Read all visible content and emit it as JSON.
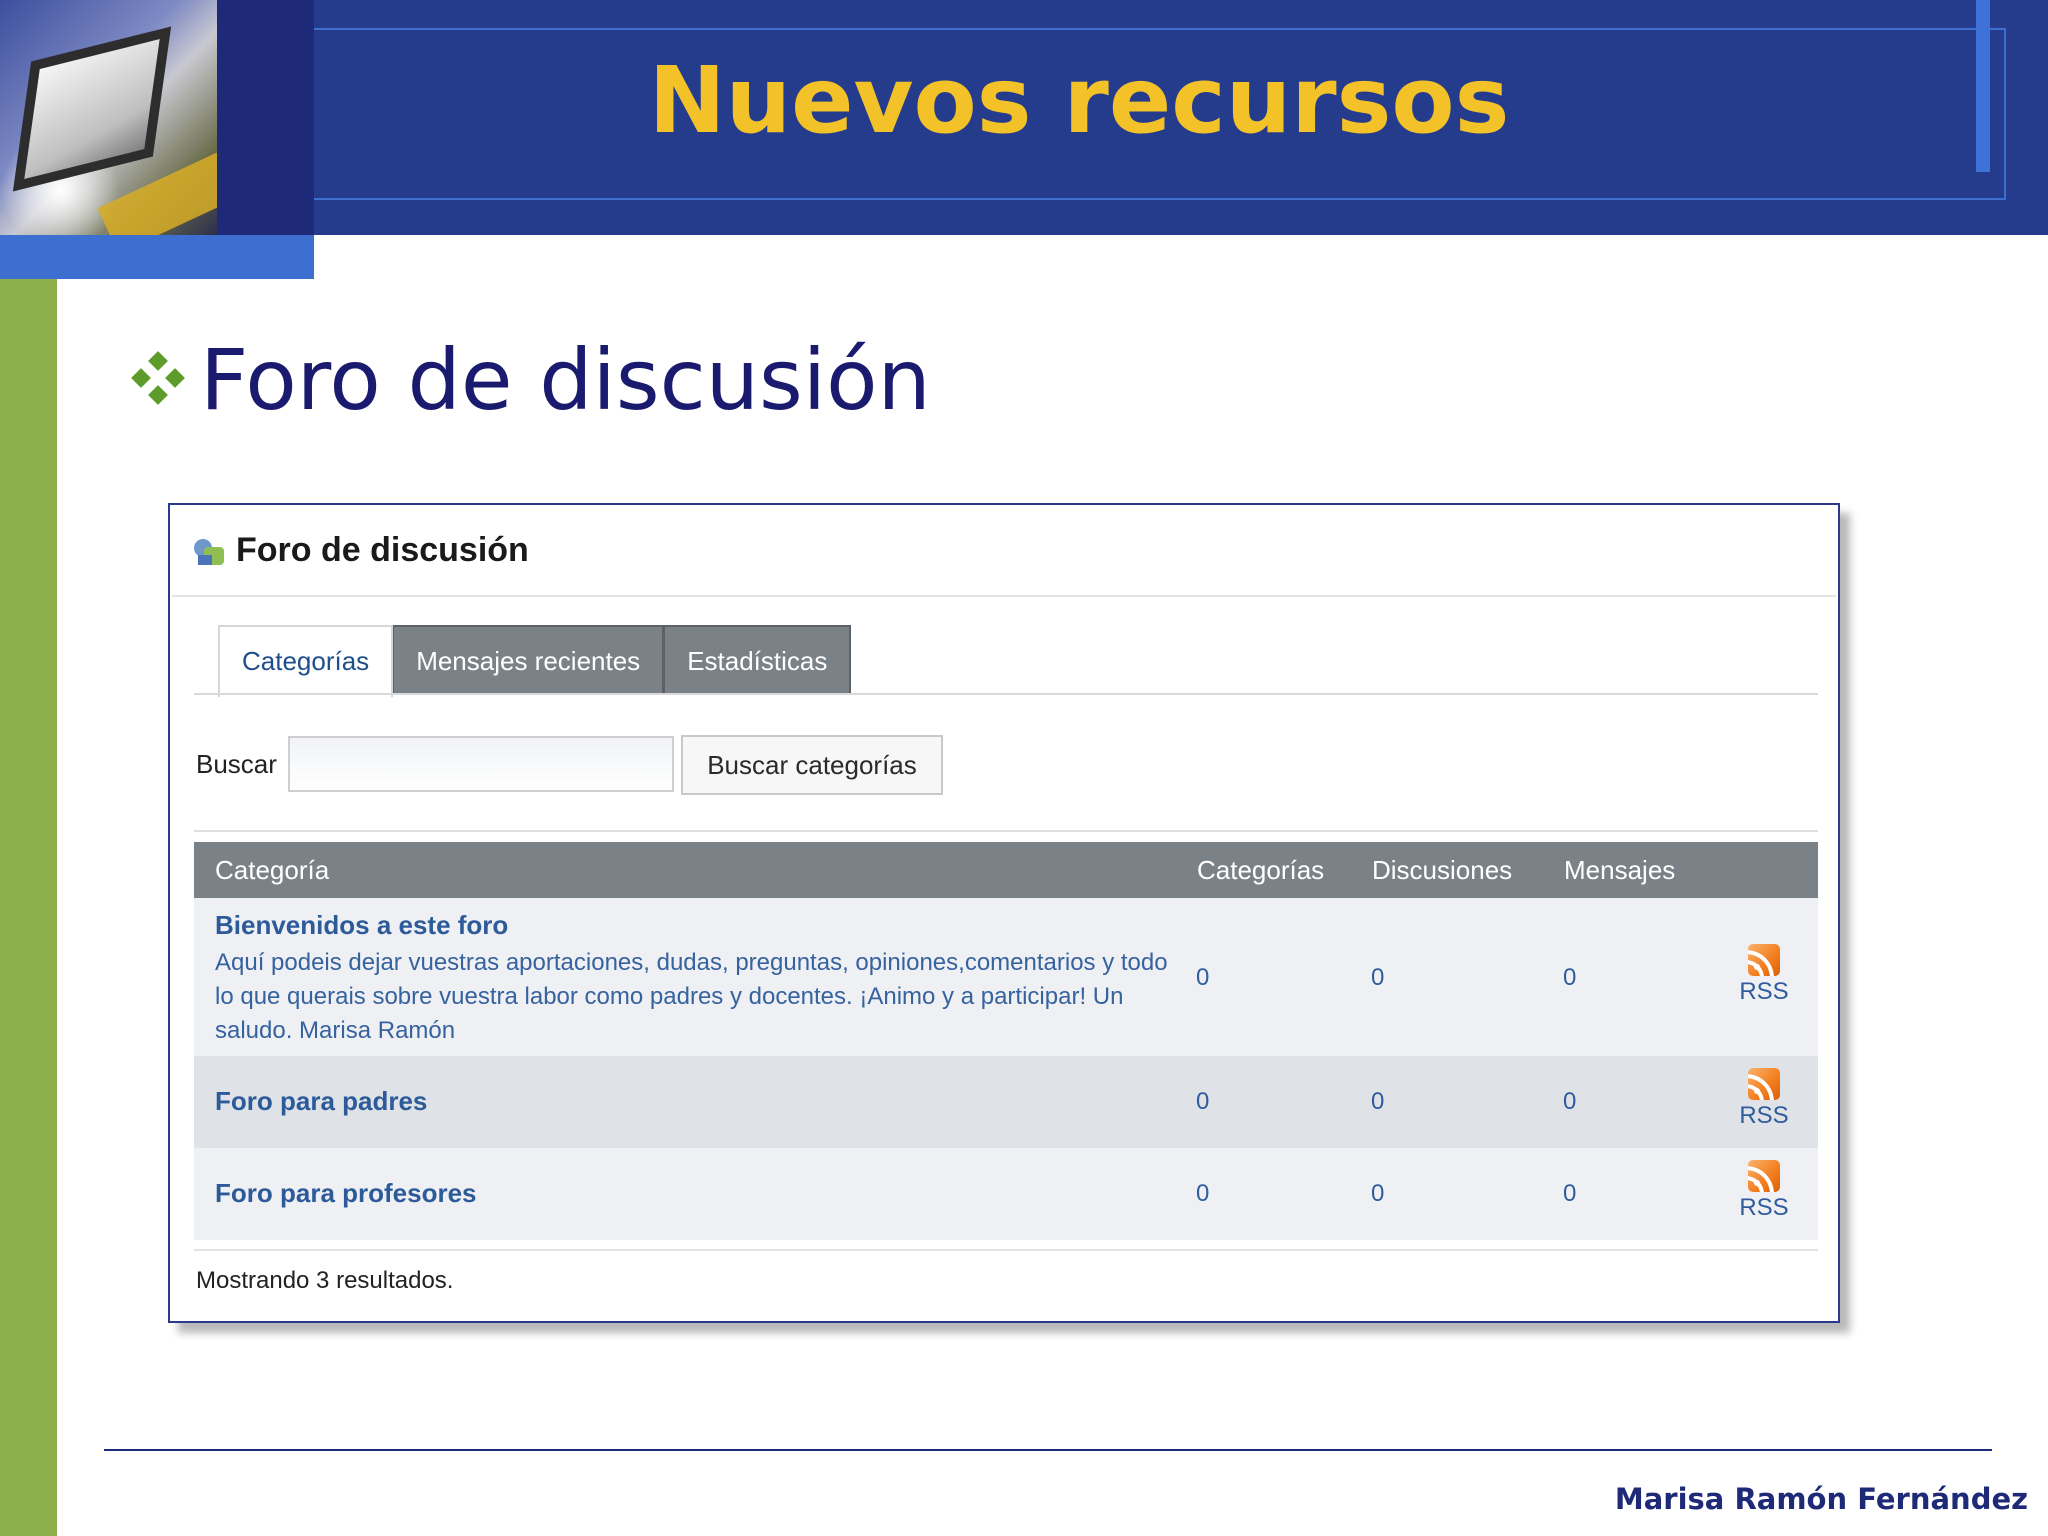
{
  "slide": {
    "title": "Nuevos recursos",
    "subtitle": "Foro de discusión",
    "author": "Marisa Ramón Fernández"
  },
  "widget": {
    "title": "Foro de discusión",
    "tabs": [
      {
        "label": "Categorías",
        "active": true
      },
      {
        "label": "Mensajes recientes",
        "active": false
      },
      {
        "label": "Estadísticas",
        "active": false
      }
    ],
    "search": {
      "label": "Buscar",
      "value": "",
      "button": "Buscar categorías"
    },
    "table": {
      "headers": [
        "Categoría",
        "Categorías",
        "Discusiones",
        "Mensajes"
      ],
      "rows": [
        {
          "name": "Bienvenidos a este foro",
          "description": "Aquí podeis dejar vuestras aportaciones, dudas, preguntas, opiniones,comentarios y todo lo que querais sobre vuestra labor como padres y docentes. ¡Animo y a participar! Un saludo. Marisa Ramón",
          "categorias": "0",
          "discusiones": "0",
          "mensajes": "0",
          "rss": "RSS"
        },
        {
          "name": "Foro para padres",
          "description": "",
          "categorias": "0",
          "discusiones": "0",
          "mensajes": "0",
          "rss": "RSS"
        },
        {
          "name": "Foro para profesores",
          "description": "",
          "categorias": "0",
          "discusiones": "0",
          "mensajes": "0",
          "rss": "RSS"
        }
      ]
    },
    "results_text": "Mostrando 3 resultados."
  },
  "colors": {
    "header_bg": "#253c8c",
    "title_gold": "#f2c228",
    "accent_green": "#8db04d",
    "tab_gray": "#7b8287",
    "link_blue": "#2d5b9a"
  }
}
